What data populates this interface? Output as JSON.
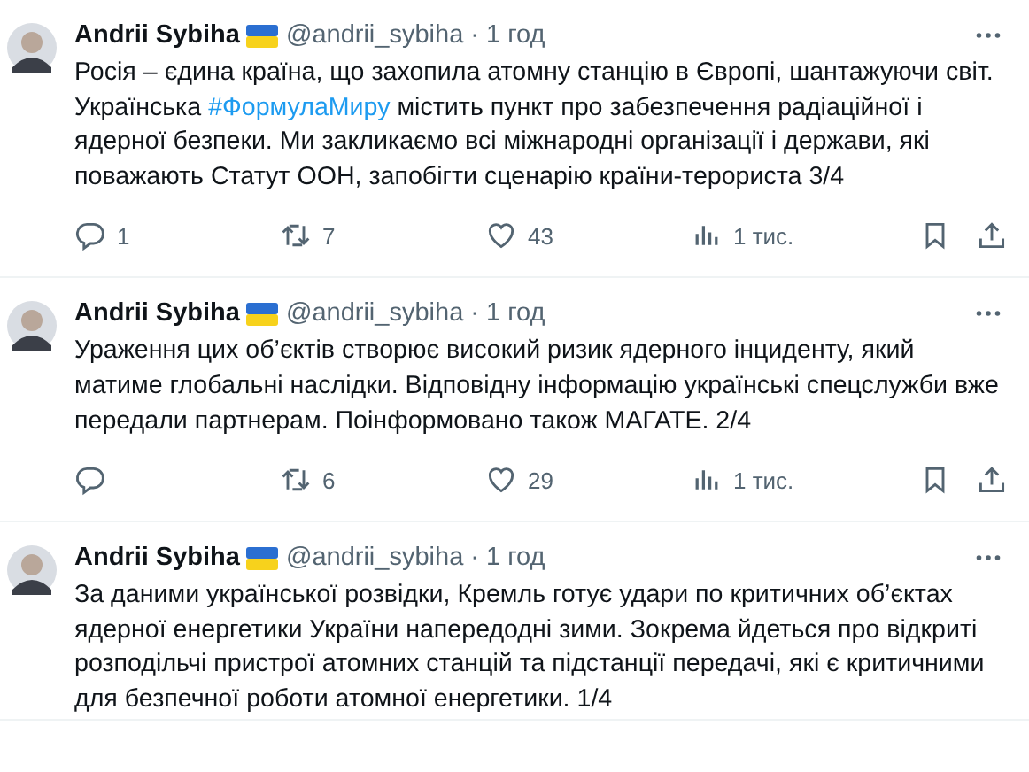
{
  "tweets": [
    {
      "name": "Andrii Sybiha",
      "handle": "@andrii_sybiha",
      "time": "· 1 год",
      "text": [
        {
          "kind": "text",
          "text": "Росія – єдина країна, що захопила атомну станцію в Європі, шантажуючи світ. Українська "
        },
        {
          "kind": "link",
          "text": "#ФормулаМиру"
        },
        {
          "kind": "text",
          "text": " містить пункт про забезпечення радіаційної і ядерної безпеки. Ми закликаємо всі міжнародні організації і держави, які поважають Статут ООН, запобігти сценарію країни-терориста 3/4"
        }
      ],
      "actions": {
        "replies": "1",
        "reposts": "7",
        "likes": "43",
        "views": "1 тис."
      }
    },
    {
      "name": "Andrii Sybiha",
      "handle": "@andrii_sybiha",
      "time": "· 1 год",
      "text": [
        {
          "kind": "text",
          "text": "Ураження цих об’єктів створює високий ризик ядерного інциденту, який матиме глобальні наслідки. Відповідну інформацію українські спецслужби вже передали партнерам. Поінформовано також МАГАТЕ. 2/4"
        }
      ],
      "actions": {
        "reposts": "6",
        "likes": "29",
        "views": "1 тис."
      }
    },
    {
      "name": "Andrii Sybiha",
      "handle": "@andrii_sybiha",
      "time": "· 1 год",
      "text": [
        {
          "kind": "text",
          "text": "За даними української розвідки, Кремль готує удари по критичних об’єктах ядерної енергетики України напередодні зими. Зокрема йдеться про відкриті розподільчі пристрої атомних станцій та підстанції передачі, які є критичними для безпечної роботи атомної енергетики. 1/4"
        }
      ]
    }
  ]
}
